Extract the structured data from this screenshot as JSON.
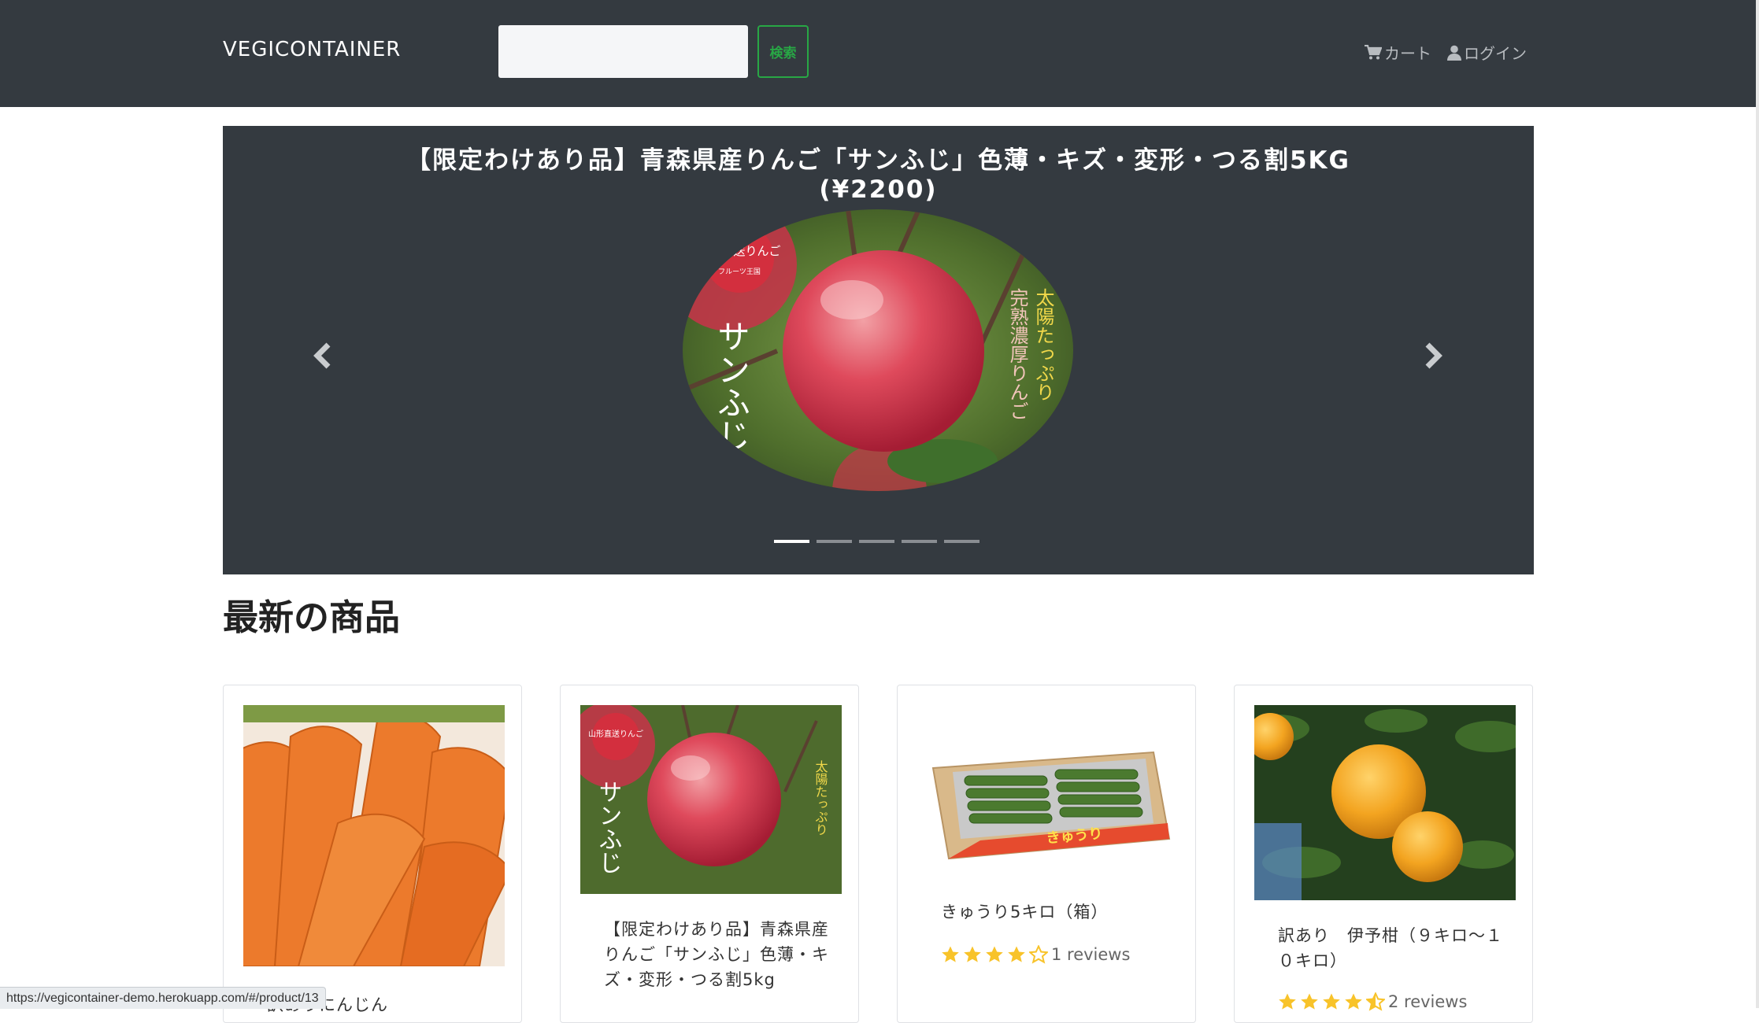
{
  "header": {
    "brand": "VEGICONTAINER",
    "search_placeholder": "",
    "search_button": "検索",
    "cart_label": "カート",
    "login_label": "ログイン"
  },
  "carousel": {
    "title": "【限定わけあり品】青森県産りんご「サンふじ」色薄・キズ・変形・つる割5KG (¥2200)",
    "slide_count": 5,
    "active_index": 0,
    "image_text": {
      "badge": "山形直送りんご",
      "badge_sub": "フルーツ王国",
      "vertical_left": "サンふじ",
      "vertical_right_1": "太陽たっぷり",
      "vertical_right_2": "完熟濃厚りんご"
    }
  },
  "section": {
    "title": "最新の商品"
  },
  "products": [
    {
      "name": "訳ありにんじん",
      "rating": 0,
      "reviews": ""
    },
    {
      "name": "【限定わけあり品】青森県産りんご「サンふじ」色薄・キズ・変形・つる割5kg",
      "rating": 0,
      "reviews": ""
    },
    {
      "name": "きゅうり5キロ（箱）",
      "rating": 4,
      "reviews": "1 reviews",
      "box_label": "きゅうり"
    },
    {
      "name": "訳あり　伊予柑（９キロ～１０キロ）",
      "rating": 4.5,
      "reviews": "2 reviews"
    }
  ],
  "status_bar": {
    "url": "https://vegicontainer-demo.herokuapp.com/#/product/13"
  },
  "colors": {
    "navbar": "#343a40",
    "accent_green": "#28a745",
    "star": "#f8c32a"
  }
}
